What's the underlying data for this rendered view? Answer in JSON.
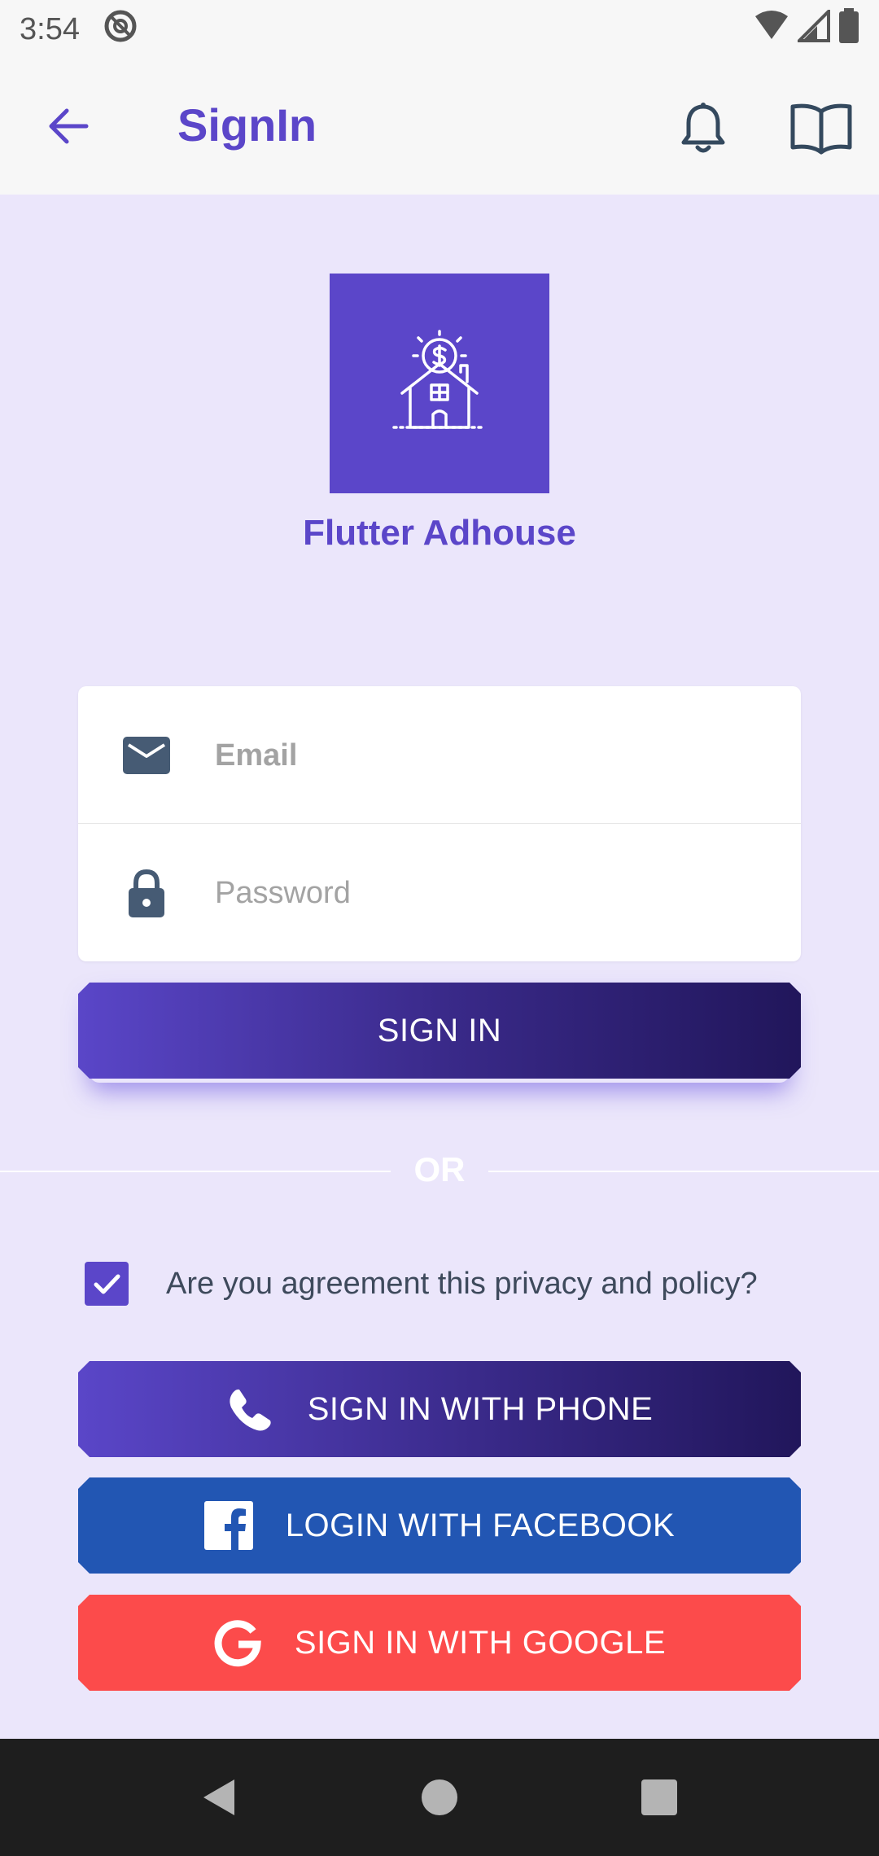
{
  "status_bar": {
    "time": "3:54"
  },
  "app_bar": {
    "title": "SignIn"
  },
  "brand": {
    "name": "Flutter Adhouse"
  },
  "form": {
    "email_placeholder": "Email",
    "password_placeholder": "Password",
    "signin_label": "SIGN IN"
  },
  "divider": {
    "label": "OR"
  },
  "agreement": {
    "text": "Are you agreement this privacy and policy?",
    "checked": true
  },
  "social": {
    "phone_label": "SIGN IN WITH PHONE",
    "facebook_label": "LOGIN WITH FACEBOOK",
    "google_label": "SIGN IN WITH GOOGLE"
  },
  "colors": {
    "primary": "#5b46c9",
    "background": "#ebe6fb",
    "facebook": "#2256b3",
    "google": "#fc4b4b",
    "gradient_dark": "#21165b"
  },
  "icons": {
    "back": "arrow-left-icon",
    "notifications": "bell-icon",
    "book": "book-open-icon",
    "email": "mail-icon",
    "password": "lock-icon",
    "phone": "phone-icon",
    "facebook": "facebook-icon",
    "google": "google-icon"
  }
}
